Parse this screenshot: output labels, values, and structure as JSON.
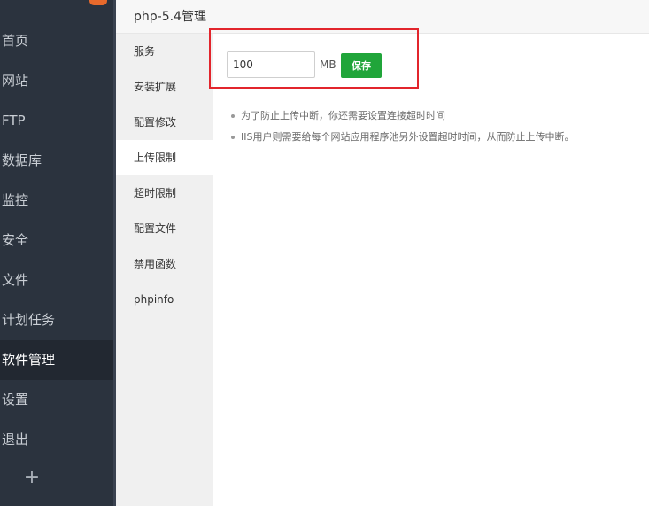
{
  "app_sidebar": {
    "nav": [
      {
        "label": "首页",
        "active": false
      },
      {
        "label": "网站",
        "active": false
      },
      {
        "label": "FTP",
        "active": false
      },
      {
        "label": "数据库",
        "active": false
      },
      {
        "label": "监控",
        "active": false
      },
      {
        "label": "安全",
        "active": false
      },
      {
        "label": "文件",
        "active": false
      },
      {
        "label": "计划任务",
        "active": false
      },
      {
        "label": "软件管理",
        "active": true
      },
      {
        "label": "设置",
        "active": false
      },
      {
        "label": "退出",
        "active": false
      }
    ],
    "add_label": "+"
  },
  "panel": {
    "title": "php-5.4管理",
    "sub_nav": [
      {
        "label": "服务",
        "active": false
      },
      {
        "label": "安装扩展",
        "active": false
      },
      {
        "label": "配置修改",
        "active": false
      },
      {
        "label": "上传限制",
        "active": true
      },
      {
        "label": "超时限制",
        "active": false
      },
      {
        "label": "配置文件",
        "active": false
      },
      {
        "label": "禁用函数",
        "active": false
      },
      {
        "label": "phpinfo",
        "active": false
      }
    ],
    "upload": {
      "value": "100",
      "unit": "MB",
      "save_label": "保存"
    },
    "notes": [
      "为了防止上传中断，你还需要设置连接超时时间",
      "IIS用户则需要给每个网站应用程序池另外设置超时时间，从而防止上传中断。"
    ]
  },
  "colors": {
    "sidebar_bg": "#2b333e",
    "accent_green": "#20a53a",
    "highlight_red": "#e2252c"
  }
}
